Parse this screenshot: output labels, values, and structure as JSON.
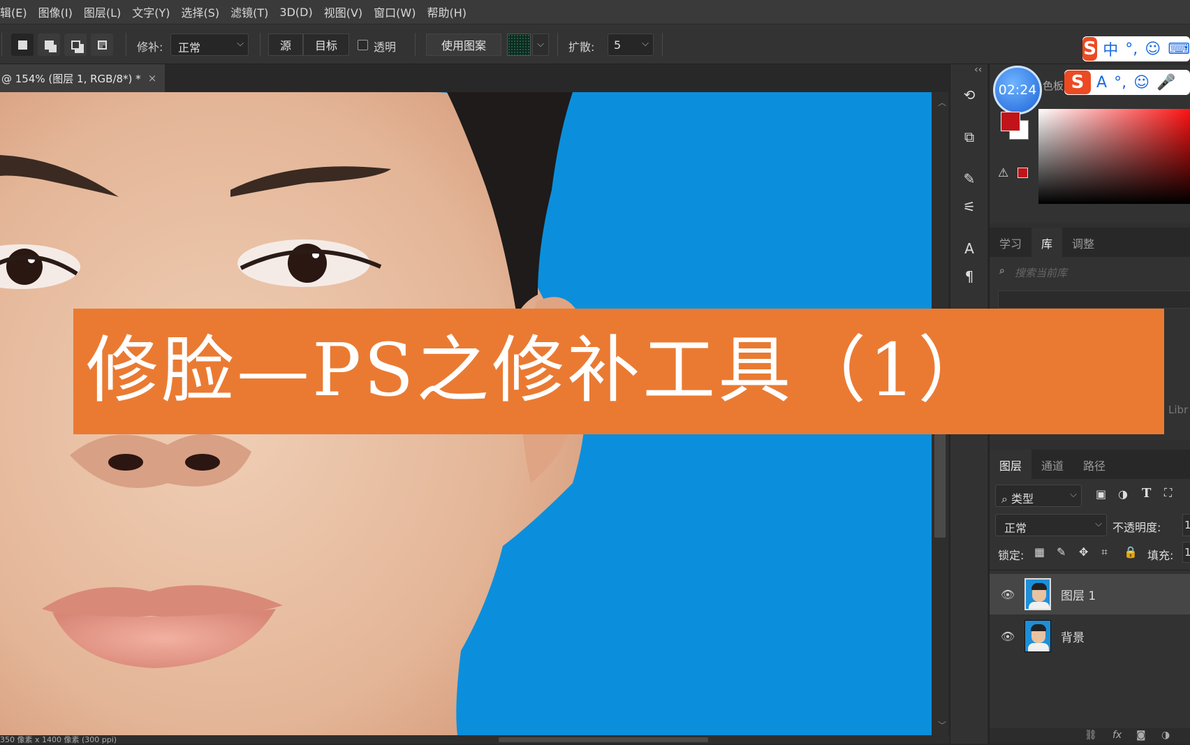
{
  "menu": [
    "辑(E)",
    "图像(I)",
    "图层(L)",
    "文字(Y)",
    "选择(S)",
    "滤镜(T)",
    "3D(D)",
    "视图(V)",
    "窗口(W)",
    "帮助(H)"
  ],
  "options": {
    "patch_label": "修补:",
    "patch_mode": "正常",
    "source_btn": "源",
    "target_btn": "目标",
    "transparent_label": "透明",
    "use_pattern_btn": "使用图案",
    "diffusion_label": "扩散:",
    "diffusion_value": "5"
  },
  "doc_tab": {
    "title": "@ 154% (图层 1, RGB/8*) *",
    "close": "×"
  },
  "status_text": "350 像素 x 1400 像素 (300 ppi)",
  "banner": {
    "title": "修脸—PS之修补工具（1）"
  },
  "timer": "02:24",
  "ime": {
    "row1": [
      "中",
      "°,",
      "☺",
      "⌨"
    ],
    "row2": [
      "A",
      "°,",
      "☺",
      "🎤"
    ]
  },
  "color_panel": {
    "tab_label": "色板"
  },
  "library_panel": {
    "tabs": [
      "学习",
      "库",
      "调整"
    ],
    "active_tab": "库",
    "search_placeholder": "搜索当前库",
    "side_text": "Libr"
  },
  "layers_panel": {
    "tabs": [
      "图层",
      "通道",
      "路径"
    ],
    "active_tab": "图层",
    "filter_label": "类型",
    "blend_mode": "正常",
    "opacity_label": "不透明度:",
    "opacity_value": "1",
    "lock_label": "锁定:",
    "fill_label": "填充:",
    "fill_value": "1",
    "layers": [
      {
        "name": "图层 1",
        "selected": true
      },
      {
        "name": "背景",
        "selected": false
      }
    ],
    "footer_icons": [
      "link-icon",
      "fx-icon",
      "mask-icon",
      "adjustment-icon"
    ]
  },
  "colors": {
    "banner": "#ea7a32",
    "canvas_bg": "#0b8fdc",
    "foreground": "#c0141a",
    "background": "#ffffff"
  }
}
